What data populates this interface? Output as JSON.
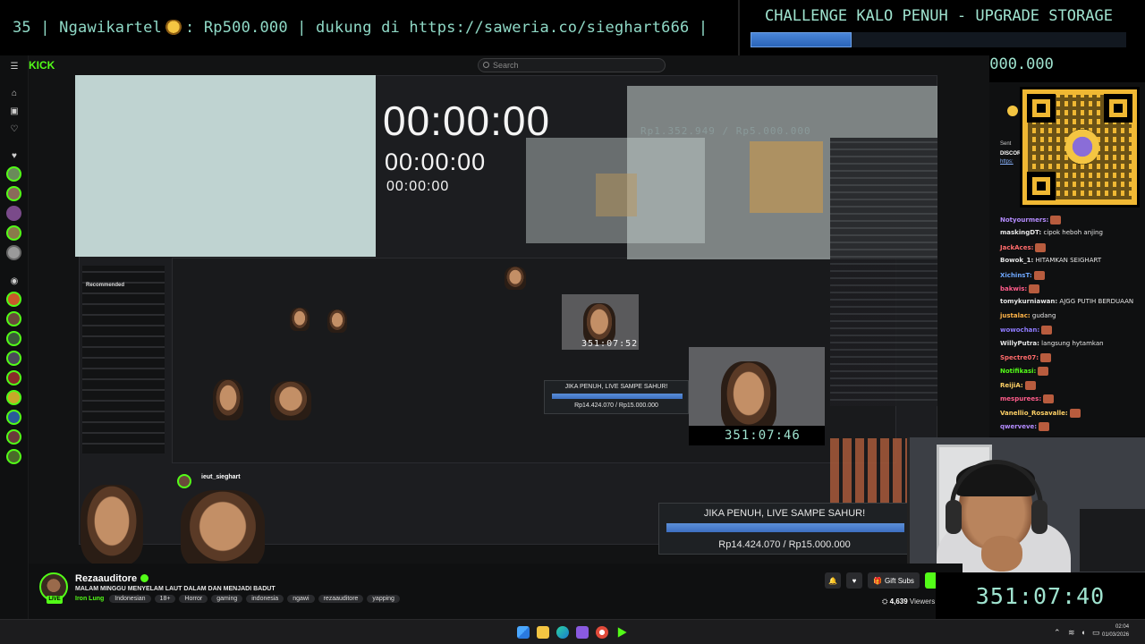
{
  "ticker": {
    "text_before_emoji": "35 | Ngawikartel",
    "text_after_emoji": ": Rp500.000 |  dukung di https://saweria.co/sieghart666 |"
  },
  "challenge": {
    "title": "CHALLENGE KALO PENUH - UPGRADE STORAGE",
    "progress_fraction": 0.27,
    "amount": "Rp1.352.949 / Rp5.000.000"
  },
  "stream_view": {
    "logo": "KICK",
    "search_placeholder": "Search",
    "timer_large": "00:00:00",
    "timer_medium": "00:00:00",
    "timer_small": "00:00:00",
    "timer_cam1": "351:07:52",
    "timer_cam2": "351:07:46",
    "nested_challenge": "Rp1.352.949 / Rp5.000.000",
    "alert_small": {
      "title": "JIKA PENUH, LIVE SAMPE SAHUR!",
      "amount": "Rp14.424.070 / Rp15.000.000"
    },
    "alert_large": {
      "title": "JIKA PENUH, LIVE SAMPE SAHUR!",
      "amount": "Rp14.424.070 / Rp15.000.000"
    },
    "nested_streamer": "ieut_sieghart",
    "recommended_label": "Recommended"
  },
  "chat": {
    "messages": [
      {
        "user": "Notyourmers:",
        "text": "",
        "color": "#b48cff",
        "emote": true
      },
      {
        "user": "maskingDT:",
        "text": " cipok heboh anjing",
        "color": "#e6e6e6",
        "emote": false
      },
      {
        "user": "JackAces:",
        "text": "",
        "color": "#ff6b6b",
        "emote": true
      },
      {
        "user": "Bowok_1:",
        "text": " HITAMKAN SEIGHART",
        "color": "#e6e6e6",
        "emote": false
      },
      {
        "user": "XichinsT:",
        "text": "",
        "color": "#6ea8ff",
        "emote": true
      },
      {
        "user": "bakwis:",
        "text": "",
        "color": "#ff5c8a",
        "emote": true
      },
      {
        "user": "tomykurniawan:",
        "text": " AJGG PUTIH BERDUAAN",
        "color": "#e6e6e6",
        "emote": false
      },
      {
        "user": "justalac:",
        "text": " gudang",
        "color": "#ffb347",
        "emote": false
      },
      {
        "user": "wowochan:",
        "text": "",
        "color": "#8f7bff",
        "emote": true
      },
      {
        "user": "WillyPutra:",
        "text": " langsung hytamkan",
        "color": "#e6e6e6",
        "emote": false
      },
      {
        "user": "Spectre07:",
        "text": "",
        "color": "#ff6b6b",
        "emote": true
      },
      {
        "user": "Notifikasi:",
        "text": "",
        "color": "#53fc18",
        "emote": true
      },
      {
        "user": "ReijiA:",
        "text": "",
        "color": "#ffd166",
        "emote": true
      },
      {
        "user": "mespurees:",
        "text": "",
        "color": "#ff5c8a",
        "emote": true
      },
      {
        "user": "Vanellio_Rosavalle:",
        "text": "",
        "color": "#ffd166",
        "emote": true
      },
      {
        "user": "qwerveve:",
        "text": "",
        "color": "#b48cff",
        "emote": true
      }
    ],
    "sent_label": "Sent",
    "discord_label": "DISCOR",
    "link_label": "https:"
  },
  "infobar": {
    "live_label": "LIVE",
    "streamer_name": "Rezaauditore",
    "stream_title": "MALAM MINGGU MENYELAM LAUT DALAM DAN MENJADI BADUT",
    "category": "Iron Lung",
    "tags": [
      "Indonesian",
      "18+",
      "Horror",
      "gaming",
      "indonesia",
      "ngawi",
      "rezaauditore",
      "yapping"
    ],
    "gift_subs_label": "Gift Subs",
    "viewers_count": "4,639",
    "viewers_label": "Viewers"
  },
  "big_timer": "351:07:40",
  "taskbar": {
    "time": "02:04",
    "date": "01/03/2026"
  }
}
